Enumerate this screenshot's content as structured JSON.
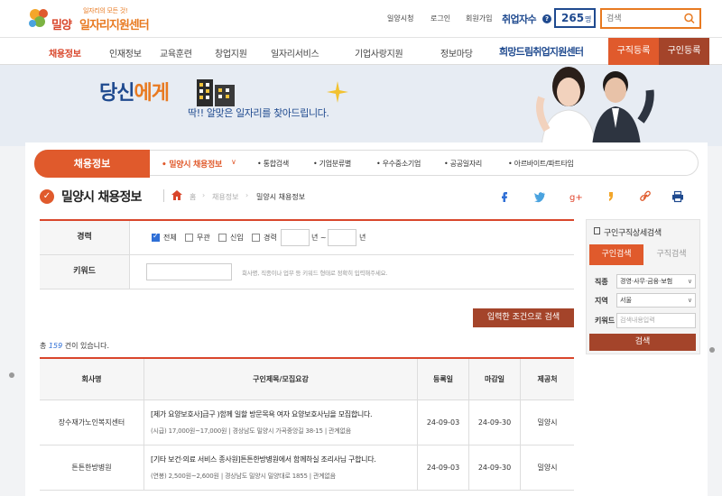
{
  "header": {
    "logo_tagline": "일자리의 모든 것!",
    "logo_city": "밀양",
    "logo_title": "일자리지원센터",
    "links": [
      "일양시청",
      "로그인",
      "회원가입"
    ],
    "jobs_label": "취업자수",
    "jobs_count": "265",
    "jobs_unit": "명",
    "search_placeholder": "검색"
  },
  "nav": {
    "items": [
      "채용정보",
      "인재정보",
      "교육훈련",
      "창업지원",
      "일자리서비스",
      "기업사랑지원",
      "정보마당"
    ],
    "hope_center": "희망드림취업지원센터",
    "btn_job": "구직등록",
    "btn_person": "구인등록"
  },
  "banner": {
    "title_a": "당신",
    "title_b": "에게",
    "subtitle": "딱!! 알맞은 일자리를 찾아드립니다."
  },
  "subnav": {
    "main": "채용정보",
    "current": "• 밀양시 채용정보",
    "items": [
      "• 통합검색",
      "• 기업분류별",
      "• 우수중소기업",
      "• 공공일자리",
      "• 아르바이트/파트타임"
    ]
  },
  "page": {
    "title": "밀양시 채용정보",
    "breadcrumb": [
      "홈",
      "채용정보",
      "밀양시 채용정보"
    ]
  },
  "form": {
    "career_label": "경력",
    "options": [
      "전체",
      "무관",
      "신입",
      "경력"
    ],
    "year_from_unit": "년 ~",
    "year_to_unit": "년",
    "keyword_label": "키워드",
    "keyword_hint": "회사명, 직종이나 업무 등 키워드 형태로 정확히 입력해주세요.",
    "submit": "입력한 조건으로 검색"
  },
  "total": {
    "prefix": "총",
    "count": "159",
    "suffix": "건이 있습니다."
  },
  "table": {
    "headers": [
      "회사명",
      "구인제목/모집요강",
      "등록일",
      "마감일",
      "제공처"
    ],
    "rows": [
      {
        "company": "장수재가노인복지센터",
        "title": "[제가 요양보호사]급구 )함께 일할 방문목욕 여자 요양보호사님을 모집합니다.",
        "meta": "(시급) 17,000원~17,000원 | 경상남도 밀양시 가곡중앙길 38-15 | 관계없음",
        "registered": "24-09-03",
        "deadline": "24-09-30",
        "provider": "밀양시"
      },
      {
        "company": "튼튼한방병원",
        "title": "[기타 보건·의료 서비스 종사원]튼튼한방병원에서 함께하실 조리사님 구합니다.",
        "meta": "(연봉) 2,500원~2,600원 | 경상남도 밀양시 밀양대로 1855 | 관계없음",
        "registered": "24-09-03",
        "deadline": "24-09-30",
        "provider": "밀양시"
      }
    ]
  },
  "side": {
    "title": "구인구직상세검색",
    "tab_on": "구인검색",
    "tab_off": "구직검색",
    "job_label": "직종",
    "job_value": "경영·사무·금융·보험",
    "region_label": "지역",
    "region_value": "서울",
    "keyword_label": "키워드",
    "keyword_placeholder": "검색내용입력",
    "submit": "검색"
  },
  "colors": {
    "brand_orange": "#e05a2c",
    "brand_brown": "#a4442a",
    "brand_navy": "#1f4a8f",
    "accent_blue": "#2f6fd6"
  }
}
